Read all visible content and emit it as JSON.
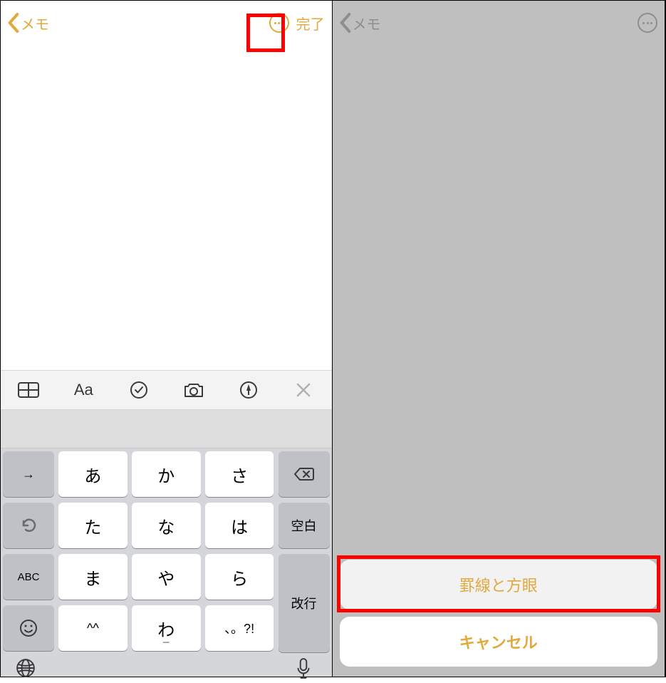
{
  "left": {
    "nav": {
      "back_label": "メモ",
      "done_label": "完了"
    },
    "toolbar": {
      "aa_label": "Aa"
    },
    "keyboard": {
      "row1": [
        "あ",
        "か",
        "さ"
      ],
      "row2": [
        "た",
        "な",
        "は"
      ],
      "row3": [
        "ま",
        "や",
        "ら"
      ],
      "row4": [
        "^^",
        "わ",
        "、。?!"
      ],
      "row4_sub": [
        "",
        "ー",
        ""
      ],
      "side": {
        "arrow": "→",
        "undo": "undo-icon",
        "abc": "ABC",
        "emoji": "emoji-icon",
        "backspace": "backspace-icon",
        "space": "空白",
        "return": "改行"
      }
    }
  },
  "right": {
    "nav": {
      "back_label": "メモ"
    },
    "sheet": {
      "option_label": "罫線と方眼",
      "cancel_label": "キャンセル"
    }
  },
  "colors": {
    "accent": "#E1A93E",
    "highlight": "#ff0000"
  }
}
